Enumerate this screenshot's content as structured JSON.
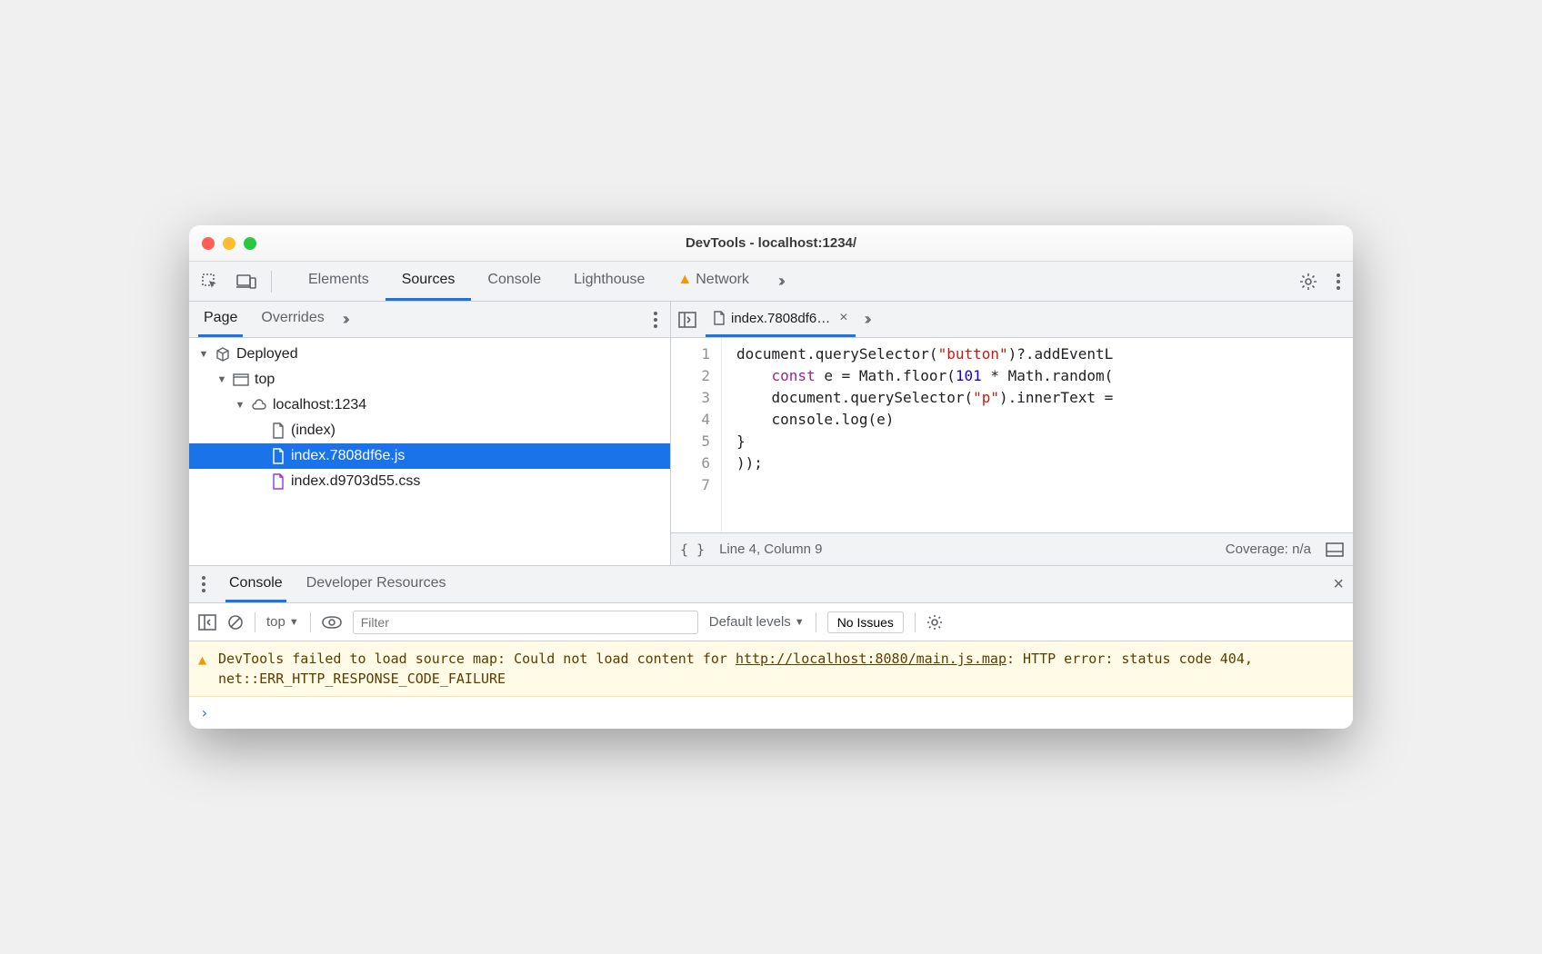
{
  "window": {
    "title": "DevTools - localhost:1234/"
  },
  "toolbar": {
    "tabs": [
      "Elements",
      "Sources",
      "Console",
      "Lighthouse",
      "Network"
    ],
    "active": "Sources",
    "warn_tab": "Network"
  },
  "left": {
    "tabs": [
      "Page",
      "Overrides"
    ],
    "active": "Page",
    "tree": {
      "root": "Deployed",
      "top": "top",
      "origin": "localhost:1234",
      "files": [
        {
          "name": "(index)",
          "kind": "doc"
        },
        {
          "name": "index.7808df6e.js",
          "kind": "js",
          "selected": true
        },
        {
          "name": "index.d9703d55.css",
          "kind": "css"
        }
      ]
    }
  },
  "editor": {
    "open_file": "index.7808df6…",
    "lines": [
      "document.querySelector(\"button\")?.addEventL",
      "    const e = Math.floor(101 * Math.random(",
      "    document.querySelector(\"p\").innerText =",
      "    console.log(e)",
      "}",
      "));",
      ""
    ],
    "status_position": "Line 4, Column 9",
    "coverage": "Coverage: n/a"
  },
  "drawer": {
    "tabs": [
      "Console",
      "Developer Resources"
    ],
    "active": "Console"
  },
  "console": {
    "context": "top",
    "filter_placeholder": "Filter",
    "levels": "Default levels",
    "issues": "No Issues",
    "warning_prefix": "DevTools failed to load source map: Could not load content for ",
    "warning_link": "http://localhost:8080/main.js.map",
    "warning_suffix": ": HTTP error: status code 404, net::ERR_HTTP_RESPONSE_CODE_FAILURE",
    "prompt": "›"
  }
}
